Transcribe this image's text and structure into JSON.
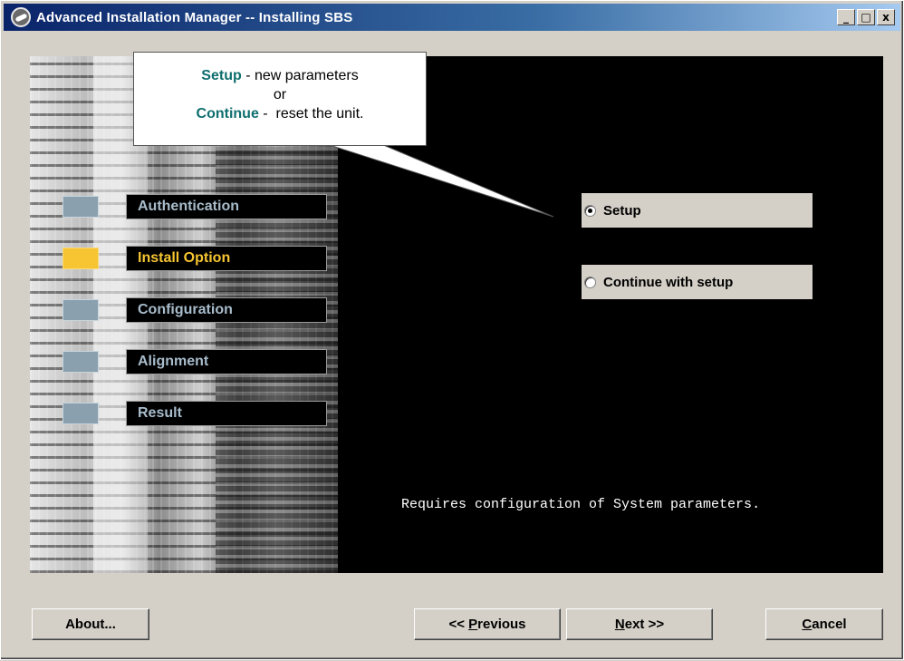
{
  "window": {
    "title": "Advanced Installation Manager -- Installing SBS"
  },
  "titlebar_buttons": {
    "minimize": "_",
    "maximize": "□",
    "close": "x"
  },
  "callout": {
    "line1_bold": "Setup",
    "line1_rest": " - new parameters",
    "line2": "or",
    "line3_bold": "Continue",
    "line3_rest": " -  reset the unit."
  },
  "steps": [
    {
      "label": "Authentication",
      "active": false
    },
    {
      "label": "Install Option",
      "active": true
    },
    {
      "label": "Configuration",
      "active": false
    },
    {
      "label": "Alignment",
      "active": false
    },
    {
      "label": "Result",
      "active": false
    }
  ],
  "options": {
    "setup": {
      "label": "Setup",
      "checked": true
    },
    "continue": {
      "label": "Continue with setup",
      "checked": false
    }
  },
  "description": "Requires configuration of System parameters.",
  "buttons": {
    "about": "About...",
    "previous_prefix": "<< ",
    "previous_mnemonic": "P",
    "previous_rest": "revious",
    "next_mnemonic": "N",
    "next_rest": "ext >>",
    "cancel_mnemonic": "C",
    "cancel_rest": "ancel"
  },
  "colors": {
    "active_step": "#f6c531",
    "inactive_step": "#8aa0ae",
    "callout_accent": "#0f6e6e"
  }
}
